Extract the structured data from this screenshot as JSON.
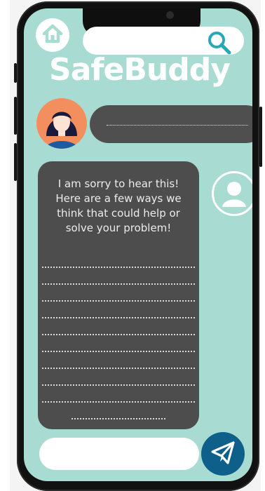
{
  "app": {
    "brand": "SafeBuddy"
  },
  "search": {
    "placeholder": ""
  },
  "chat": {
    "reply_text": "I am sorry to hear this! Here are a few ways we think that could help or solve your problem!"
  },
  "composer": {
    "placeholder": ""
  },
  "icons": {
    "home": "home-icon",
    "search": "search-icon",
    "bot_avatar": "woman-avatar-icon",
    "user_avatar": "user-profile-icon",
    "send": "send-paper-plane-icon"
  },
  "colors": {
    "screen_bg": "#a8dcd2",
    "bubble_bg": "#4d4d4d",
    "avatar_bg": "#f38f5e",
    "send_bg": "#0e5f8a",
    "accent": "#2aa7b4"
  }
}
